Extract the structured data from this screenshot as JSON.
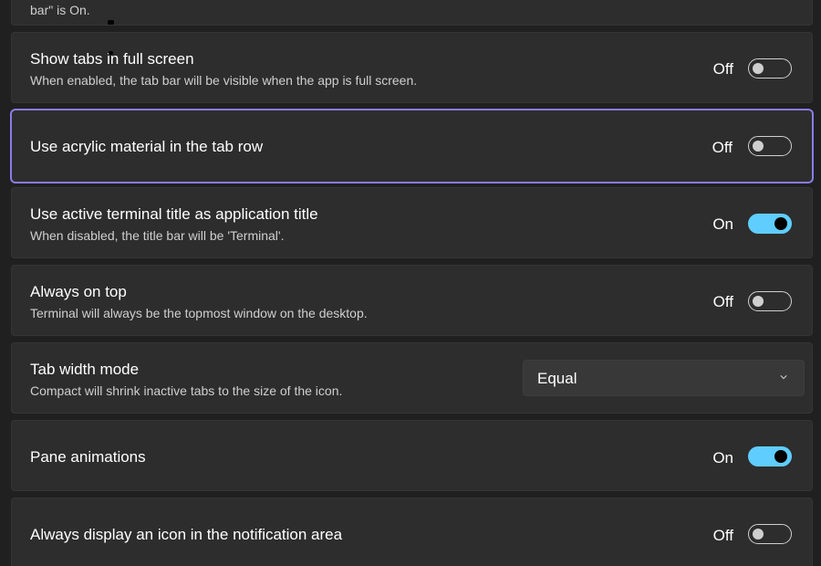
{
  "partial_top": {
    "desc": "bar\" is On."
  },
  "settings": [
    {
      "title": "Show tabs in full screen",
      "desc": "When enabled, the tab bar will be visible when the app is full screen.",
      "state": "Off"
    },
    {
      "title": "Use acrylic material in the tab row",
      "desc": "",
      "state": "Off"
    },
    {
      "title": "Use active terminal title as application title",
      "desc": "When disabled, the title bar will be 'Terminal'.",
      "state": "On"
    },
    {
      "title": "Always on top",
      "desc": "Terminal will always be the topmost window on the desktop.",
      "state": "Off"
    },
    {
      "title": "Tab width mode",
      "desc": "Compact will shrink inactive tabs to the size of the icon.",
      "dropdown_value": "Equal"
    },
    {
      "title": "Pane animations",
      "desc": "",
      "state": "On"
    },
    {
      "title": "Always display an icon in the notification area",
      "desc": "",
      "state": "Off"
    }
  ],
  "colors": {
    "accent": "#60cdff",
    "focus_ring": "#8a7be8",
    "card_bg": "#2d2d2d",
    "page_bg": "#202020"
  }
}
